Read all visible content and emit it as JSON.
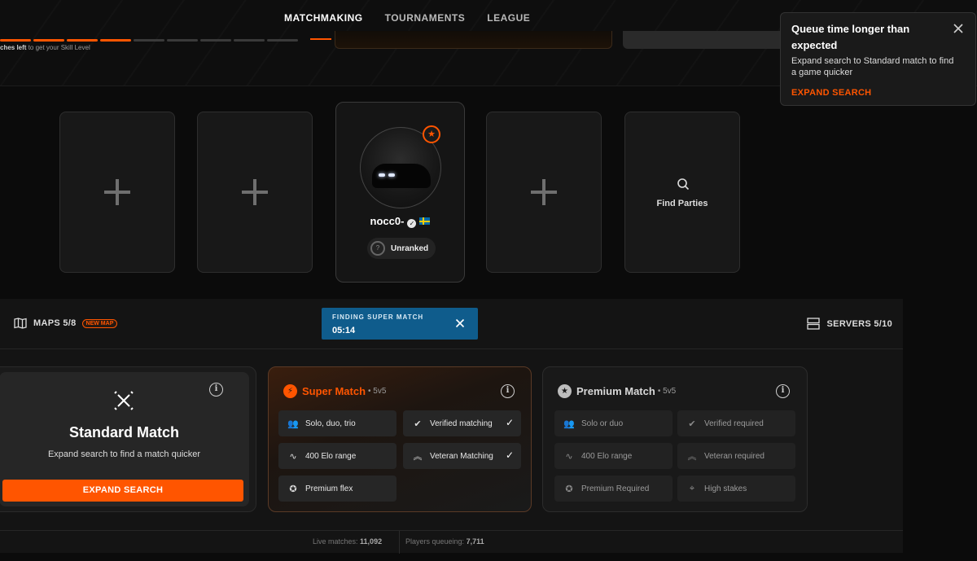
{
  "nav": {
    "items": [
      "MATCHMAKING",
      "TOURNAMENTS",
      "LEAGUE"
    ],
    "active": "MATCHMAKING"
  },
  "skill": {
    "text_prefix": "ches left",
    "text_suffix": " to get your Skill Level"
  },
  "toast": {
    "title": "Queue time longer than expected",
    "body": "Expand search to Standard match to find a game quicker",
    "action": "EXPAND SEARCH"
  },
  "party": {
    "player": {
      "name": "nocc0-",
      "rank": "Unranked",
      "flag": "sweden-flag",
      "rank_icon": "?"
    },
    "find_parties_label": "Find Parties"
  },
  "queue_bar": {
    "maps_label": "MAPS 5/8",
    "new_map_badge": "NEW MAP",
    "finding_title": "FINDING SUPER MATCH",
    "finding_time": "05:14",
    "servers_label": "SERVERS 5/10"
  },
  "modes": {
    "standard": {
      "title": "Standard Match",
      "subtitle": "Expand search to find a match quicker",
      "button": "EXPAND SEARCH"
    },
    "super": {
      "name": "Super Match",
      "format": "• 5v5",
      "features": [
        "Solo, duo, trio",
        "Verified matching",
        "400 Elo range",
        "Veteran Matching",
        "Premium flex"
      ]
    },
    "premium": {
      "name": "Premium Match",
      "format": "• 5v5",
      "features": [
        "Solo or duo",
        "Verified required",
        "400 Elo range",
        "Veteran required",
        "Premium Required",
        "High stakes"
      ]
    }
  },
  "footer": {
    "live_label": "Live matches:",
    "live_value": "11,092",
    "queue_label": "Players queueing:",
    "queue_value": "7,711"
  },
  "colors": {
    "accent": "#ff5500",
    "finding_bg": "#0f5c8c"
  }
}
